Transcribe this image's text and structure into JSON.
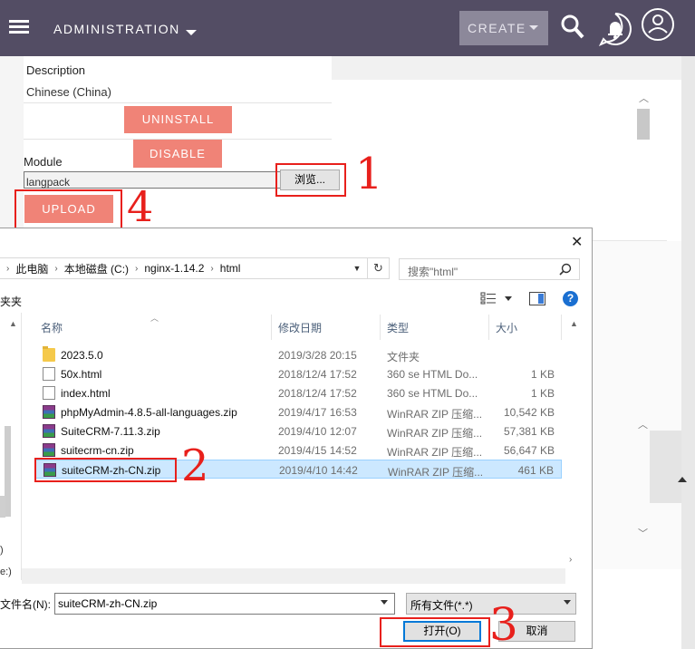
{
  "crm": {
    "nav_title": "ADMINISTRATION",
    "create_label": "CREATE",
    "description_label": "Description",
    "description_value": "Chinese (China)",
    "uninstall_label": "UNINSTALL",
    "disable_label": "DISABLE",
    "module_label": "Module",
    "file_value": "langpack",
    "browse_label": "浏览...",
    "upload_label": "UPLOAD",
    "colors": {
      "header": "#534d64",
      "button": "#f08377"
    }
  },
  "annotations": [
    "1",
    "2",
    "3",
    "4"
  ],
  "dialog": {
    "breadcrumb": [
      "此电脑",
      "本地磁盘 (C:)",
      "nginx-1.14.2",
      "html"
    ],
    "search_placeholder": "搜索\"html\"",
    "toolbar_new": "夹夹",
    "columns": {
      "name": "名称",
      "date": "修改日期",
      "type": "类型",
      "size": "大小"
    },
    "files": [
      {
        "icon": "folder-icon",
        "name": "2023.5.0",
        "date": "2019/3/28 20:15",
        "type": "文件夹",
        "size": ""
      },
      {
        "icon": "html-file-icon",
        "name": "50x.html",
        "date": "2018/12/4 17:52",
        "type": "360 se HTML Do...",
        "size": "1 KB"
      },
      {
        "icon": "html-file-icon",
        "name": "index.html",
        "date": "2018/12/4 17:52",
        "type": "360 se HTML Do...",
        "size": "1 KB"
      },
      {
        "icon": "winrar-icon",
        "name": "phpMyAdmin-4.8.5-all-languages.zip",
        "date": "2019/4/17 16:53",
        "type": "WinRAR ZIP 压缩...",
        "size": "10,542 KB"
      },
      {
        "icon": "winrar-icon",
        "name": "SuiteCRM-7.11.3.zip",
        "date": "2019/4/10 12:07",
        "type": "WinRAR ZIP 压缩...",
        "size": "57,381 KB"
      },
      {
        "icon": "winrar-icon",
        "name": "suitecrm-cn.zip",
        "date": "2019/4/15 14:52",
        "type": "WinRAR ZIP 压缩...",
        "size": "56,647 KB"
      },
      {
        "icon": "winrar-icon",
        "name": "suiteCRM-zh-CN.zip",
        "date": "2019/4/10 14:42",
        "type": "WinRAR ZIP 压缩...",
        "size": "461 KB",
        "selected": true
      }
    ],
    "nav_pane_text": [
      ")",
      "e:)"
    ],
    "filename_label": "文件名(N):",
    "filename_value": "suiteCRM-zh-CN.zip",
    "filter_value": "所有文件(*.*)",
    "open_label": "打开(O)",
    "cancel_label": "取消"
  }
}
